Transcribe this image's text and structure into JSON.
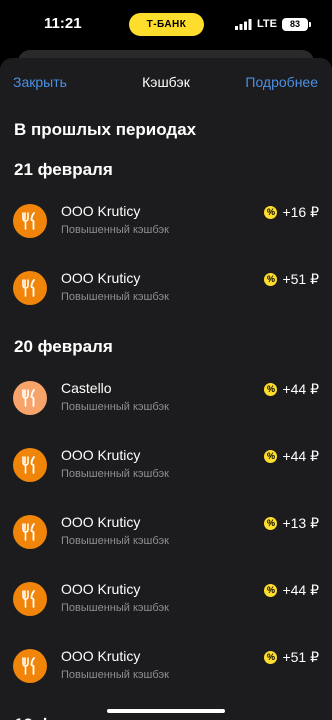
{
  "status_bar": {
    "time": "11:21",
    "bank_badge": "Т-БАНК",
    "network": "LTE",
    "battery": "83"
  },
  "nav": {
    "close_label": "Закрыть",
    "title": "Кэшбэк",
    "more_label": "Подробнее"
  },
  "section_title": "В прошлых периодах",
  "groups": [
    {
      "date": "21 февраля",
      "items": [
        {
          "name": "ООО Kruticy",
          "subtitle": "Повышенный кэшбэк",
          "amount": "+16 ₽",
          "icon": "fork-knife-icon"
        },
        {
          "name": "ООО Kruticy",
          "subtitle": "Повышенный кэшбэк",
          "amount": "+51 ₽",
          "icon": "fork-knife-icon"
        }
      ]
    },
    {
      "date": "20 февраля",
      "items": [
        {
          "name": "Castello",
          "subtitle": "Повышенный кэшбэк",
          "amount": "+44 ₽",
          "icon": "fork-knife-icon"
        },
        {
          "name": "ООО Kruticy",
          "subtitle": "Повышенный кэшбэк",
          "amount": "+44 ₽",
          "icon": "fork-knife-icon"
        },
        {
          "name": "ООО Kruticy",
          "subtitle": "Повышенный кэшбэк",
          "amount": "+13 ₽",
          "icon": "fork-knife-icon"
        },
        {
          "name": "ООО Kruticy",
          "subtitle": "Повышенный кэшбэк",
          "amount": "+44 ₽",
          "icon": "fork-knife-icon"
        },
        {
          "name": "ООО Kruticy",
          "subtitle": "Повышенный кэшбэк",
          "amount": "+51 ₽",
          "icon": "fork-knife-icon"
        }
      ]
    },
    {
      "date": "19 ф",
      "items": []
    }
  ],
  "colors": {
    "accent": "#4a90e2",
    "brand_yellow": "#ffdd2d",
    "icon_orange": "#f0850a",
    "icon_light_orange": "#f7a46a",
    "sheet_bg": "#1c1c1e"
  }
}
